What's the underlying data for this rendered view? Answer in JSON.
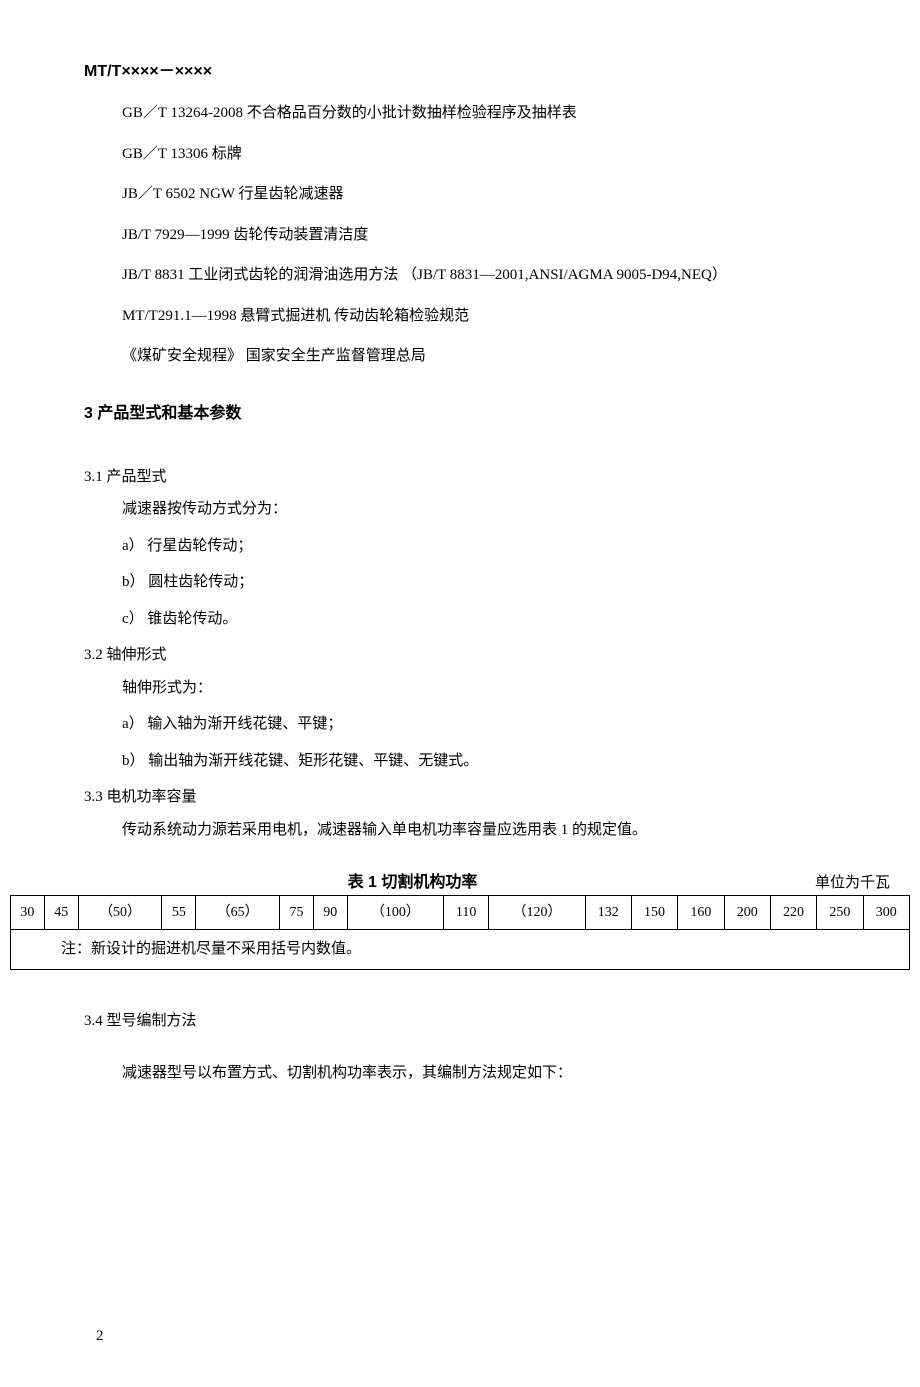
{
  "doc_id": "MT/T××××－××××",
  "references": [
    "GB／T 13264-2008  不合格品百分数的小批计数抽样检验程序及抽样表",
    "GB／T 13306  标牌",
    "JB／T 6502  NGW 行星齿轮减速器",
    "JB/T 7929—1999  齿轮传动装置清洁度",
    "JB/T 8831  工业闭式齿轮的润滑油选用方法 （JB/T 8831—2001,ANSI/AGMA 9005-D94,NEQ）",
    "MT/T291.1—1998  悬臂式掘进机  传动齿轮箱检验规范",
    "《煤矿安全规程》 国家安全生产监督管理总局"
  ],
  "section3": {
    "title": "3  产品型式和基本参数",
    "s31": {
      "title": "3.1  产品型式",
      "intro": "减速器按传动方式分为：",
      "items": [
        "a） 行星齿轮传动；",
        "b） 圆柱齿轮传动；",
        "c） 锥齿轮传动。"
      ]
    },
    "s32": {
      "title": "3.2  轴伸形式",
      "intro": "轴伸形式为：",
      "items": [
        "a） 输入轴为渐开线花键、平键；",
        "b） 输出轴为渐开线花键、矩形花键、平键、无键式。"
      ]
    },
    "s33": {
      "title": "3.3  电机功率容量",
      "para": "传动系统动力源若采用电机，减速器输入单电机功率容量应选用表 1 的规定值。"
    },
    "s34": {
      "title": "3.4  型号编制方法",
      "para": "减速器型号以布置方式、切割机构功率表示，其编制方法规定如下："
    }
  },
  "table1": {
    "caption": "表 1  切割机构功率",
    "unit": "单位为千瓦",
    "values": [
      "30",
      "45",
      "（50）",
      "55",
      "（65）",
      "75",
      "90",
      "（100）",
      "110",
      "（120）",
      "132",
      "150",
      "160",
      "200",
      "220",
      "250",
      "300"
    ],
    "note": "注：新设计的掘进机尽量不采用括号内数值。"
  },
  "page_number": "2",
  "chart_data": {
    "type": "table",
    "title": "表 1 切割机构功率",
    "unit": "kW",
    "values_raw": [
      "30",
      "45",
      "(50)",
      "55",
      "(65)",
      "75",
      "90",
      "(100)",
      "110",
      "(120)",
      "132",
      "150",
      "160",
      "200",
      "220",
      "250",
      "300"
    ],
    "values_numeric": [
      30,
      45,
      50,
      55,
      65,
      75,
      90,
      100,
      110,
      120,
      132,
      150,
      160,
      200,
      220,
      250,
      300
    ],
    "bracketed_values": [
      50,
      65,
      100,
      120
    ],
    "note": "新设计的掘进机尽量不采用括号内数值。"
  }
}
